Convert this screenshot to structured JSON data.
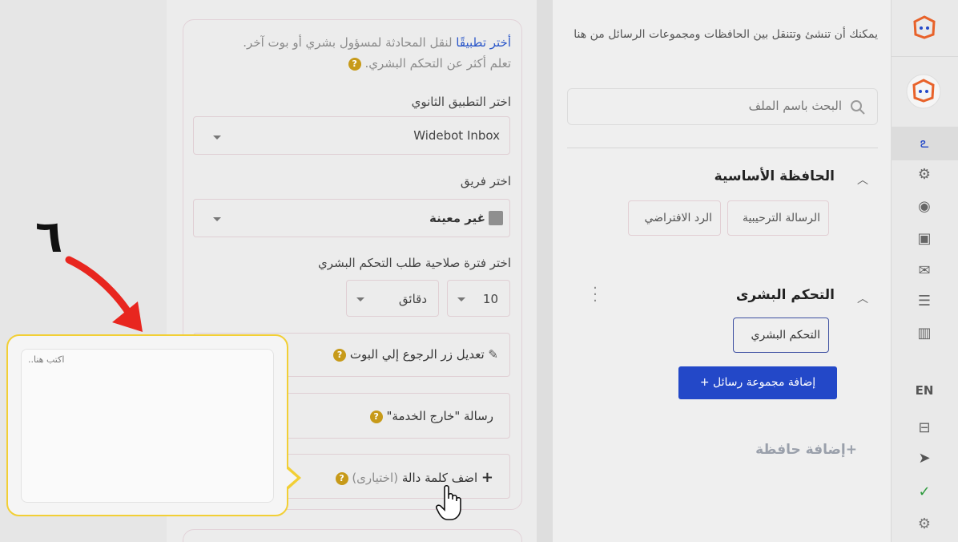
{
  "step_number": "٦",
  "secondary_app": {
    "intro_link": "أختر تطبيقًا",
    "intro_rest": " لنقل المحادثة لمسؤول بشري أو بوت آخر.",
    "intro_line2": "تعلم أكثر عن التحكم البشري.",
    "app_label": "اختر التطبيق الثانوي",
    "app_value": "Widebot Inbox",
    "team_label": "اختر فريق",
    "team_value": "غير معينة",
    "validity_label": "اختر فترة صلاحية طلب التحكم البشري",
    "validity_number": "10",
    "validity_unit": "دقائق",
    "edit_back_button": "تعديل زر الرجوع إلي البوت",
    "out_of_service": "رسالة \"خارج الخدمة\"",
    "add_keyword": "اضف كلمة دالة",
    "add_keyword_optional": "(اختيارى)"
  },
  "popup": {
    "placeholder": "اكتب هنا.."
  },
  "flows_panel": {
    "description": "يمكنك أن تنشئ وتتنقل بين الحافظات ومجموعات الرسائل من هنا",
    "search_placeholder": "البحث باسم الملف",
    "main_folder_title": "الحافظة الأساسية",
    "welcome_message": "الرسالة الترحيبية",
    "default_reply": "الرد الافتراضي",
    "human_control_title": "التحكم البشرى",
    "human_control_chip": "التحكم البشري",
    "add_group_button": "إضافة مجموعة رسائل",
    "add_folder": "إضافة حافظة"
  },
  "sidebar": {
    "language": "EN"
  },
  "colors": {
    "accent_blue": "#2348c8",
    "brand_orange": "#e8622a",
    "highlight_yellow": "#f2cf35",
    "arrow_red": "#e8261f"
  }
}
